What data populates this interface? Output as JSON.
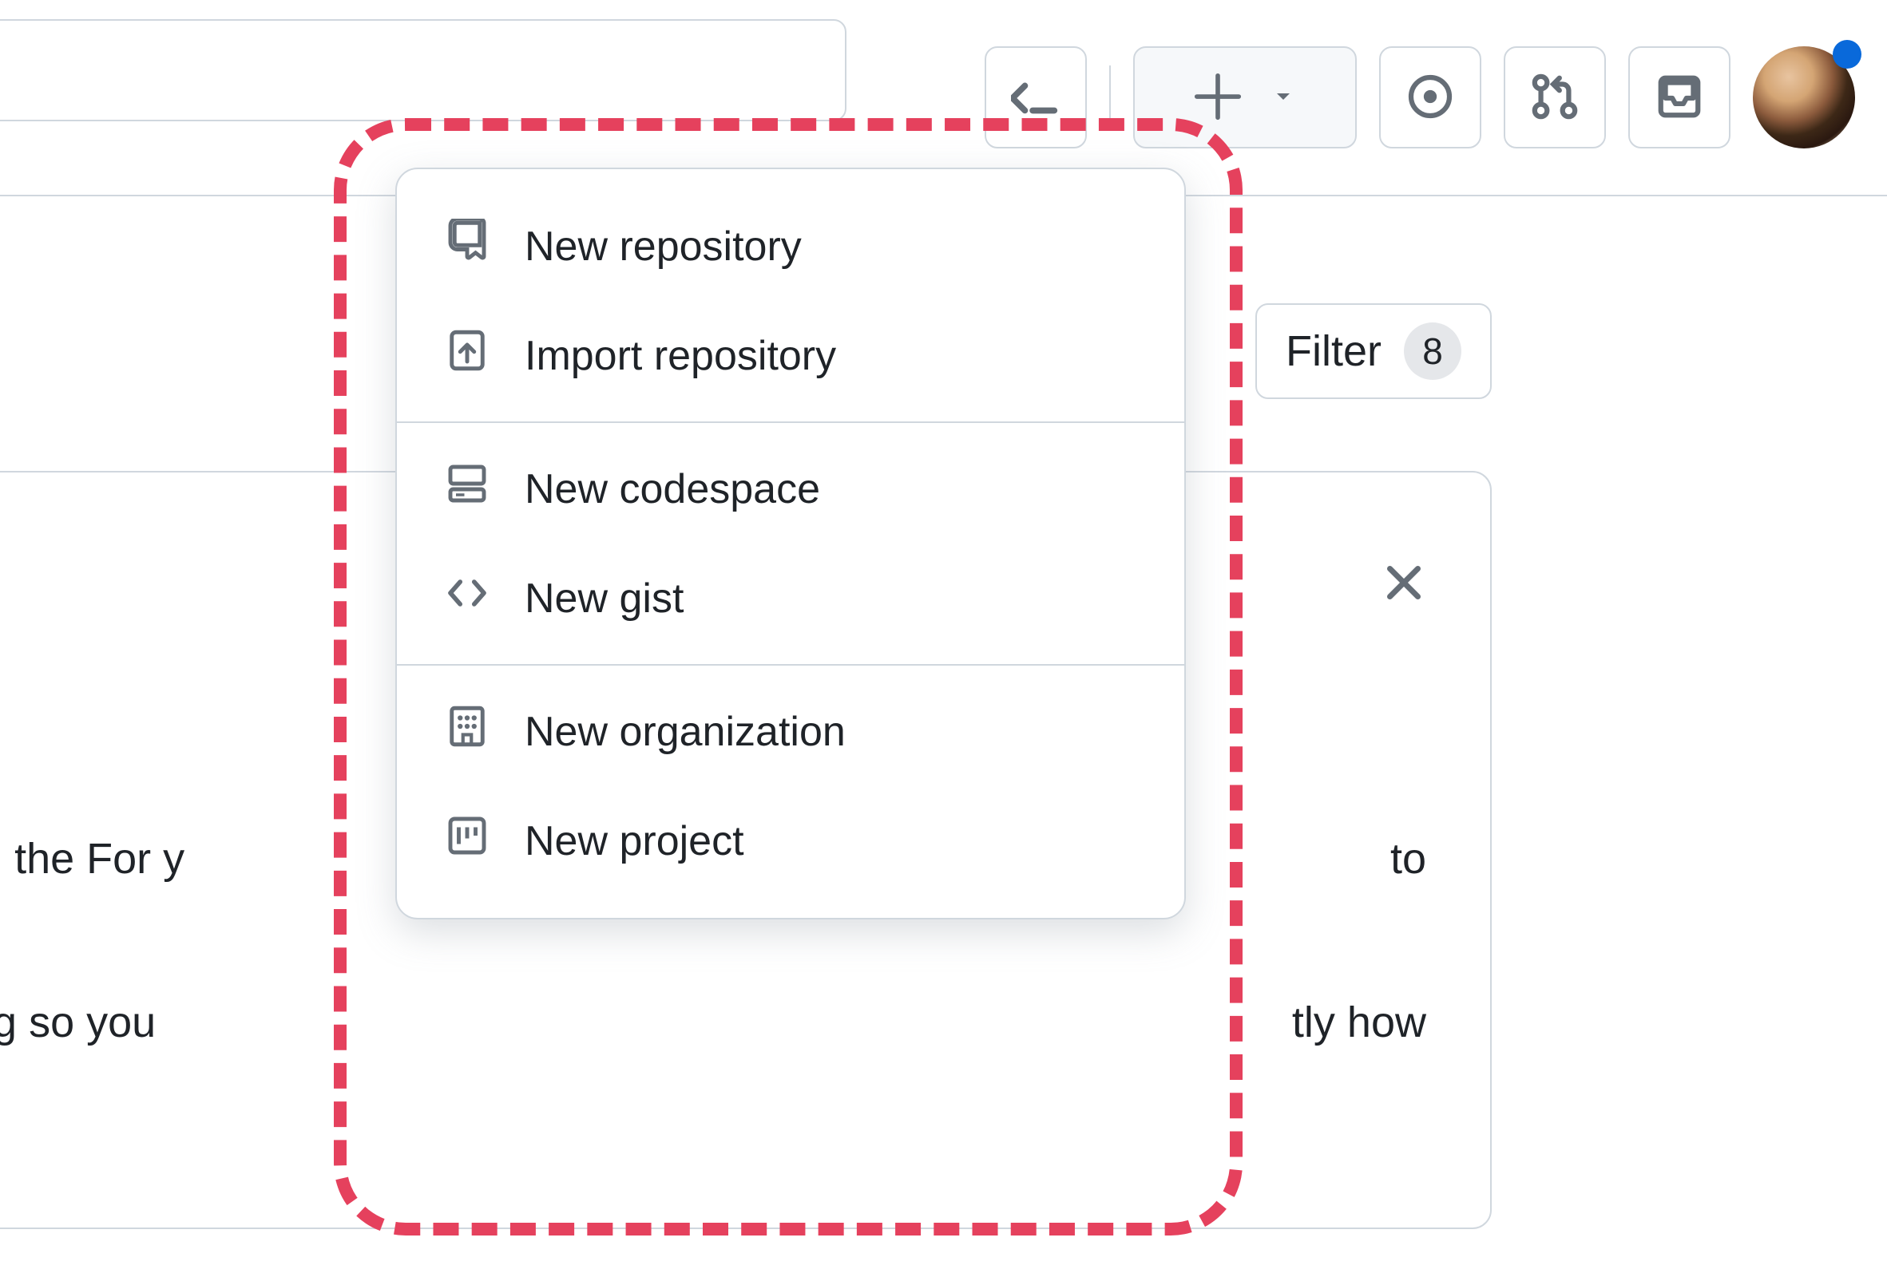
{
  "header": {
    "search_placeholder": "",
    "create_menu_open": true
  },
  "notification_dot": true,
  "filter": {
    "label": "Filter",
    "count": "8"
  },
  "card": {
    "body_fragment_line1": "d with the For y",
    "body_fragment_line2": "iltering so you",
    "body_fragment_right1": "to",
    "body_fragment_right2": "tly how"
  },
  "dropdown": {
    "groups": [
      [
        {
          "icon": "repo-icon",
          "label": "New repository"
        },
        {
          "icon": "repo-push-icon",
          "label": "Import repository"
        }
      ],
      [
        {
          "icon": "codespaces-icon",
          "label": "New codespace"
        },
        {
          "icon": "code-icon",
          "label": "New gist"
        }
      ],
      [
        {
          "icon": "organization-icon",
          "label": "New organization"
        },
        {
          "icon": "project-icon",
          "label": "New project"
        }
      ]
    ]
  },
  "colors": {
    "highlight": "#e5415d",
    "border": "#d0d7de",
    "accent": "#0969da"
  }
}
